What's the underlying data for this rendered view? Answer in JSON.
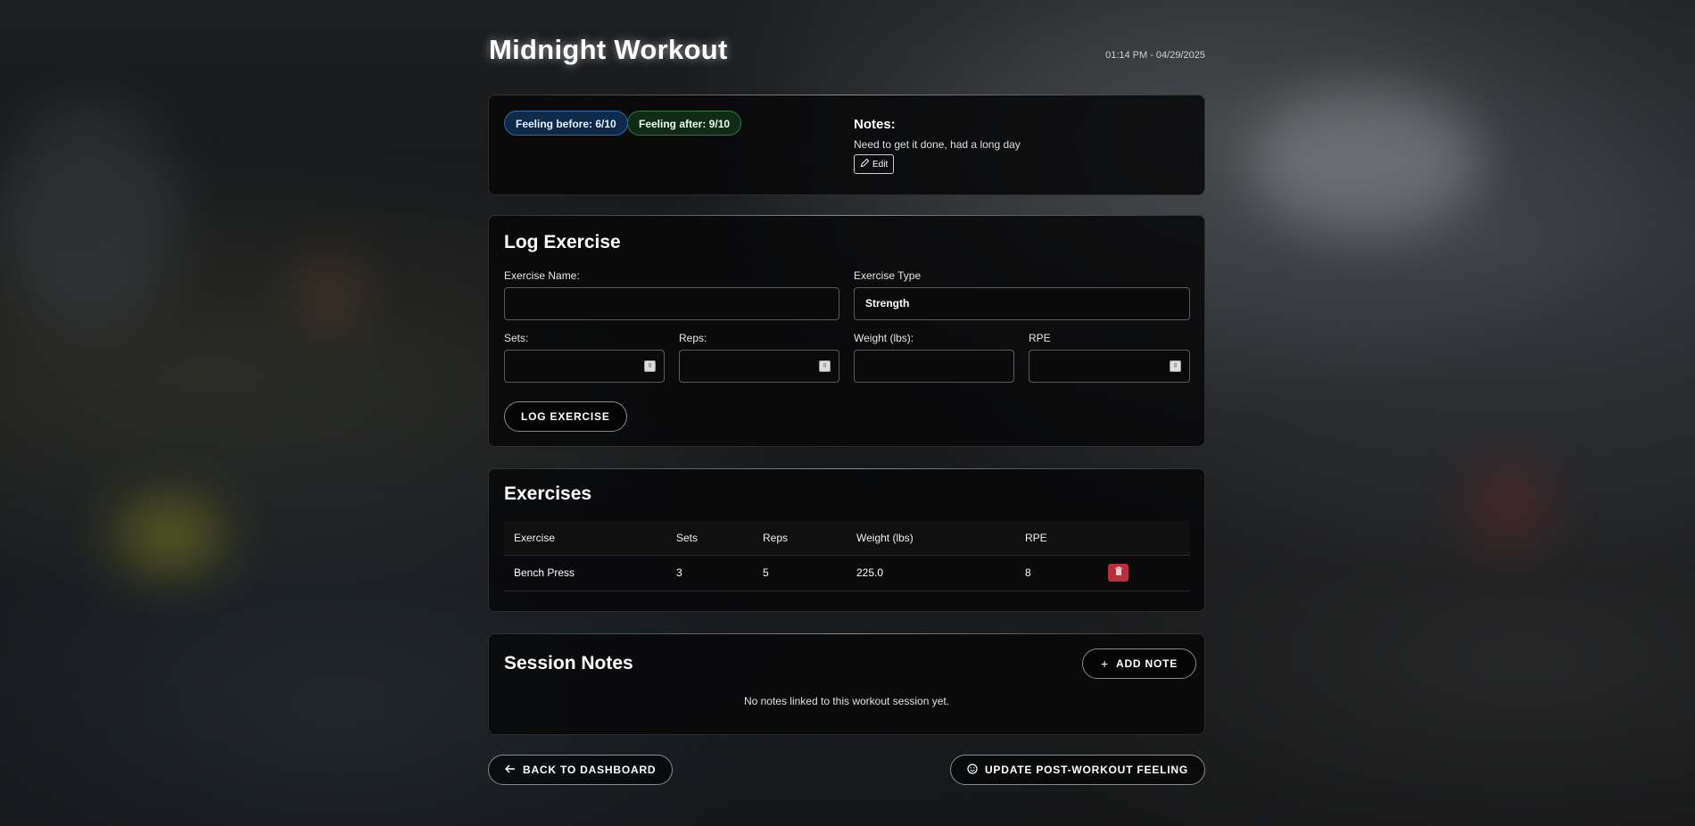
{
  "header": {
    "title": "Midnight Workout",
    "timestamp": "01:14 PM - 04/29/2025"
  },
  "summary": {
    "feeling_before": "Feeling before: 6/10",
    "feeling_after": "Feeling after: 9/10",
    "notes_label": "Notes:",
    "notes_text": "Need to get it done, had a long day",
    "edit_label": "Edit"
  },
  "log_exercise": {
    "title": "Log Exercise",
    "exercise_name_label": "Exercise Name:",
    "exercise_name_value": "",
    "exercise_type_label": "Exercise Type",
    "exercise_type_value": "Strength",
    "sets_label": "Sets:",
    "reps_label": "Reps:",
    "weight_label": "Weight (lbs):",
    "rpe_label": "RPE",
    "submit_label": "LOG EXERCISE"
  },
  "exercises": {
    "title": "Exercises",
    "columns": [
      "Exercise",
      "Sets",
      "Reps",
      "Weight (lbs)",
      "RPE"
    ],
    "rows": [
      {
        "exercise": "Bench Press",
        "sets": "3",
        "reps": "5",
        "weight": "225.0",
        "rpe": "8"
      }
    ]
  },
  "session_notes": {
    "title": "Session Notes",
    "add_label": "ADD NOTE",
    "empty_text": "No notes linked to this workout session yet."
  },
  "footer": {
    "back_label": "BACK TO DASHBOARD",
    "update_label": "UPDATE POST-WORKOUT FEELING"
  },
  "colors": {
    "delete": "#b3303c",
    "pill_before": "#0e2a4a",
    "pill_after": "#0f2a17"
  },
  "icons": [
    "pencil-icon",
    "trash-icon",
    "plus-icon",
    "arrow-left-icon",
    "smile-icon"
  ]
}
